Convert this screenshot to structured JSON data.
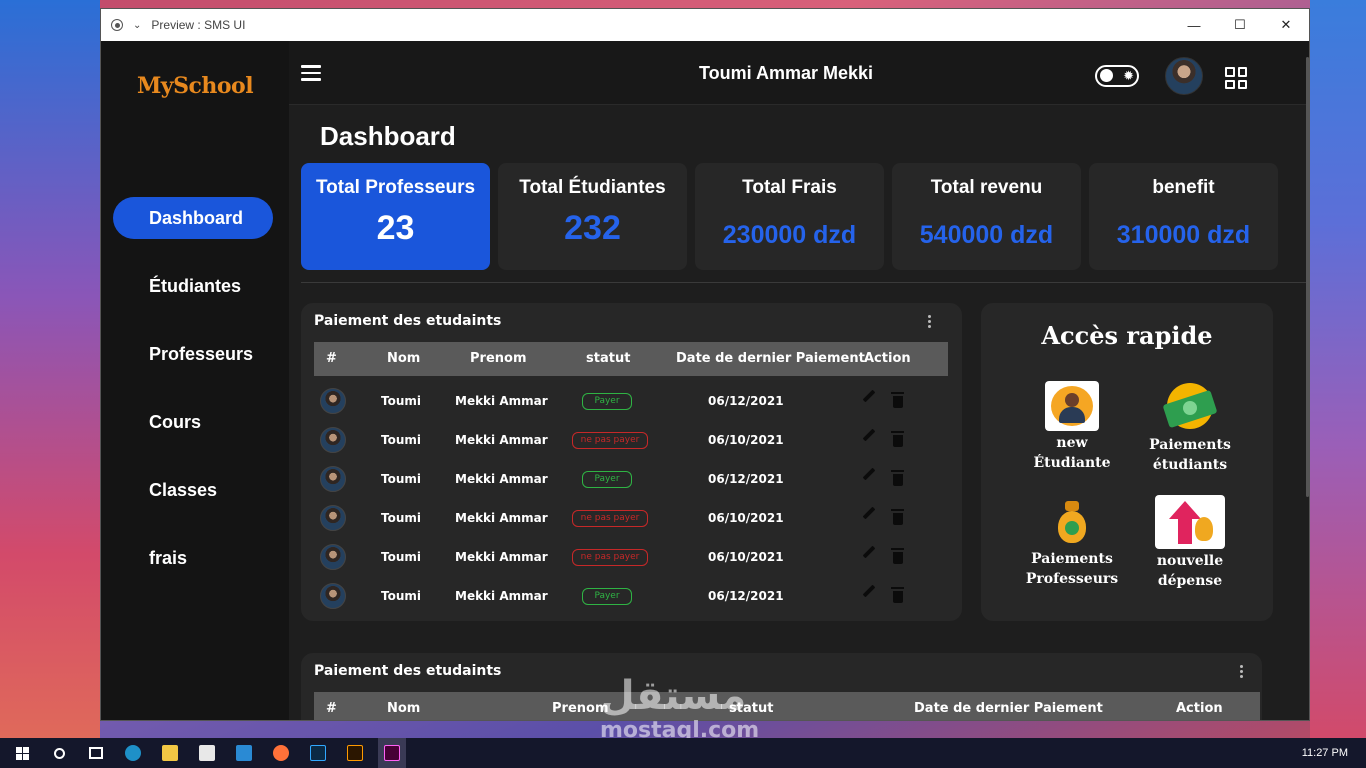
{
  "window": {
    "title": "Preview : SMS UI",
    "controls": [
      "—",
      "☐",
      "✕"
    ]
  },
  "sidebar": {
    "logo": "MySchool",
    "items": [
      {
        "label": "Dashboard",
        "active": true
      },
      {
        "label": "Étudiantes"
      },
      {
        "label": "Professeurs"
      },
      {
        "label": "Cours"
      },
      {
        "label": "Classes"
      },
      {
        "label": "frais"
      }
    ]
  },
  "header": {
    "username": "Toumi Ammar Mekki"
  },
  "page": {
    "title": "Dashboard"
  },
  "stats": [
    {
      "label": "Total Professeurs",
      "value": "23"
    },
    {
      "label": "Total Étudiantes",
      "value": "232"
    },
    {
      "label": "Total Frais",
      "value": "230000 dzd"
    },
    {
      "label": "Total revenu",
      "value": "540000 dzd"
    },
    {
      "label": "benefit",
      "value": "310000 dzd"
    }
  ],
  "payments_table": {
    "title": "Paiement des etudaints",
    "columns": [
      "#",
      "Nom",
      "Prenom",
      "statut",
      "Date de dernier Paiement",
      "Action"
    ],
    "rows": [
      {
        "nom": "Toumi",
        "prenom": "Mekki Ammar",
        "statut": "Payer",
        "paid": true,
        "date": "06/12/2021"
      },
      {
        "nom": "Toumi",
        "prenom": "Mekki Ammar",
        "statut": "ne pas payer",
        "paid": false,
        "date": "06/10/2021"
      },
      {
        "nom": "Toumi",
        "prenom": "Mekki Ammar",
        "statut": "Payer",
        "paid": true,
        "date": "06/12/2021"
      },
      {
        "nom": "Toumi",
        "prenom": "Mekki Ammar",
        "statut": "ne pas payer",
        "paid": false,
        "date": "06/10/2021"
      },
      {
        "nom": "Toumi",
        "prenom": "Mekki Ammar",
        "statut": "ne pas payer",
        "paid": false,
        "date": "06/10/2021"
      },
      {
        "nom": "Toumi",
        "prenom": "Mekki Ammar",
        "statut": "Payer",
        "paid": true,
        "date": "06/12/2021"
      }
    ]
  },
  "quick_access": {
    "title": "Accès rapide",
    "items": [
      {
        "label_line1": "new",
        "label_line2": "Étudiante"
      },
      {
        "label_line1": "Paiements",
        "label_line2": "étudiants"
      },
      {
        "label_line1": "Paiements",
        "label_line2": "Professeurs"
      },
      {
        "label_line1": "nouvelle",
        "label_line2": "dépense"
      }
    ]
  },
  "payments_table_2": {
    "title": "Paiement des etudaints",
    "columns": [
      "#",
      "Nom",
      "Prenom",
      "statut",
      "Date de dernier Paiement",
      "Action"
    ]
  },
  "watermark": {
    "arabic": "مستقل",
    "latin": "mostaql.com"
  },
  "taskbar": {
    "time": "11:27 PM"
  },
  "colors": {
    "accent": "#1a56db",
    "paid": "#2fb344",
    "unpaid": "#c62828",
    "logo": "#e8891e"
  }
}
